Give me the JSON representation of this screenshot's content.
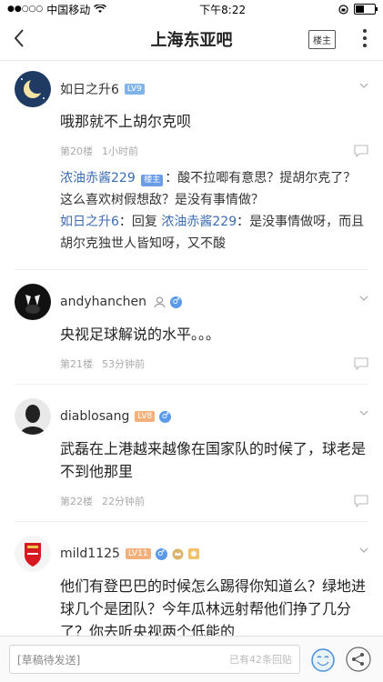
{
  "status": {
    "carrier": "中国移动",
    "time": "下午8:22"
  },
  "nav": {
    "title": "上海东亚吧",
    "owner_button": "楼主"
  },
  "posts": [
    {
      "user": "如日之升6",
      "level": "LV9",
      "body": "哦那就不上胡尔克呗",
      "floor": "第20楼",
      "time": "1小时前",
      "replies": [
        {
          "author": "浓油赤酱229",
          "tag": "楼主",
          "text": "：酸不拉唧有意思？提胡尔克了？这么喜欢树假想敌？是没有事情做？"
        },
        {
          "author": "如日之升6",
          "text": "：回复 ",
          "mention": "浓油赤酱229",
          "text2": "：是没事情做呀，而且胡尔克独世人皆知呀，又不酸"
        }
      ]
    },
    {
      "user": "andyhanchen",
      "body": "央视足球解说的水平。。。",
      "floor": "第21楼",
      "time": "53分钟前"
    },
    {
      "user": "diablosang",
      "level": "LV8",
      "body": "武磊在上港越来越像在国家队的时候了，球老是不到他那里",
      "floor": "第22楼",
      "time": "22分钟前"
    },
    {
      "user": "mild1125",
      "level": "LV11",
      "body": "他们有登巴巴的时候怎么踢得你知道么？绿地进球几个是团队？今年瓜林远射帮他们挣了几分了？你去听央视两个低能的"
    }
  ],
  "bottom": {
    "draft": "[草稿待发送]",
    "reply_count": "已有42条回贴"
  }
}
